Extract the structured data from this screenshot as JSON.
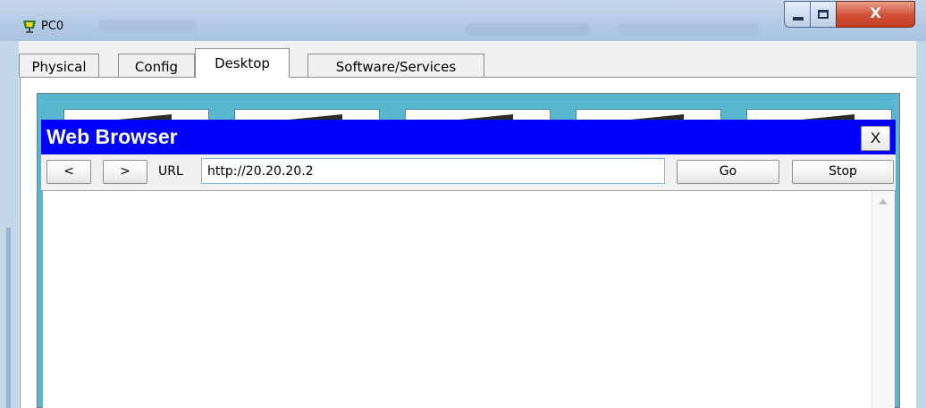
{
  "window": {
    "title": "PC0",
    "minimize_icon": "minimize-icon",
    "maximize_icon": "maximize-icon",
    "close_icon": "close-icon",
    "close_glyph": "X"
  },
  "tabs": [
    {
      "label": "Physical",
      "active": false
    },
    {
      "label": "Config",
      "active": false
    },
    {
      "label": "Desktop",
      "active": true
    },
    {
      "label": "Software/Services",
      "active": false
    }
  ],
  "desktop": {
    "background_color": "#58b7cf"
  },
  "browser": {
    "title": "Web Browser",
    "title_bar_color": "#0000ff",
    "close_label": "X",
    "back_label": "<",
    "forward_label": ">",
    "url_label": "URL",
    "url_value": "http://20.20.20.2",
    "go_label": "Go",
    "stop_label": "Stop"
  }
}
